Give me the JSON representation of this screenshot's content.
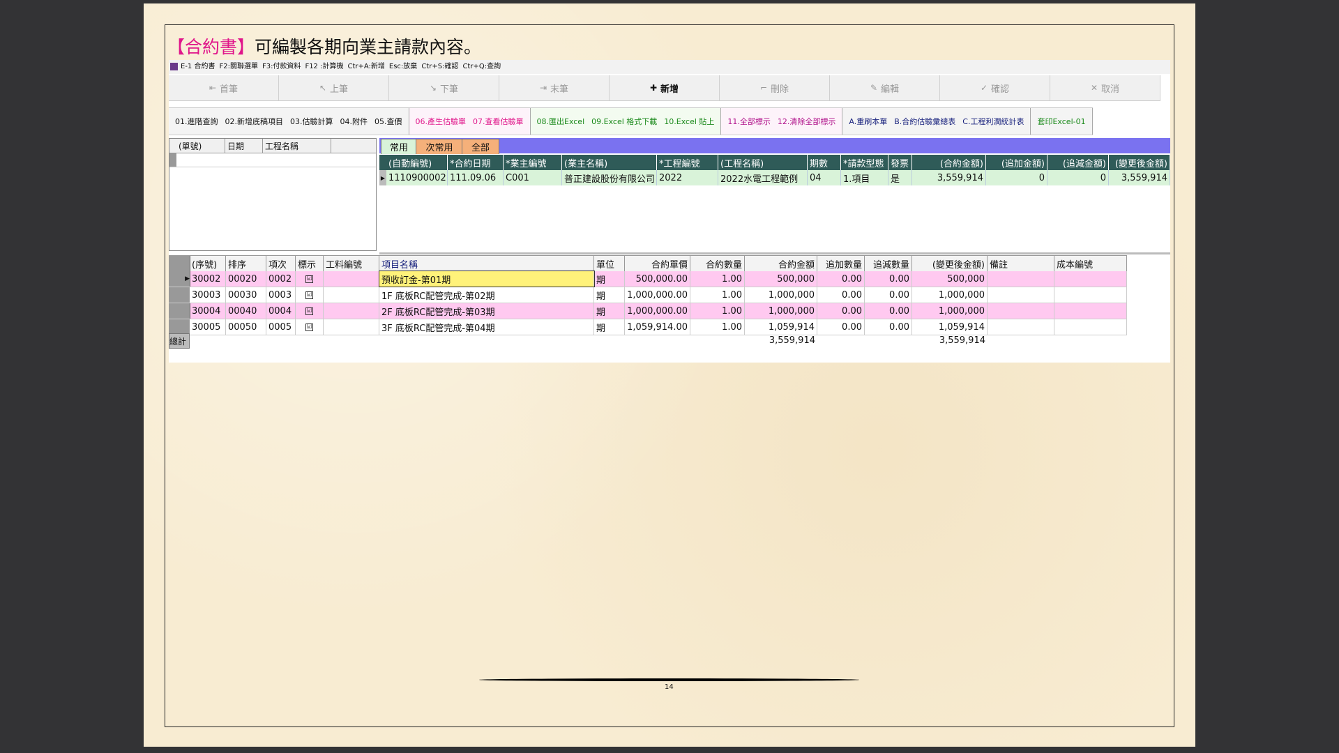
{
  "heading": {
    "bracket": "【合約書】",
    "text": "可編製各期向業主請款內容。"
  },
  "hotkeys": [
    "E-1 合約書",
    "F2:關聯選單",
    "F3:付款資料",
    "F12 :計算機",
    "Ctr+A:新增",
    "Esc:放棄",
    "Ctr+S:確認",
    "Ctr+Q:查詢"
  ],
  "nav": [
    {
      "label": "首筆",
      "glyph": "⇤",
      "active": false
    },
    {
      "label": "上筆",
      "glyph": "↖",
      "active": false
    },
    {
      "label": "下筆",
      "glyph": "↘",
      "active": false
    },
    {
      "label": "末筆",
      "glyph": "⇥",
      "active": false
    },
    {
      "label": "新增",
      "glyph": "✚",
      "active": true
    },
    {
      "label": "刪除",
      "glyph": "⌐",
      "active": false
    },
    {
      "label": "編輯",
      "glyph": "✎",
      "active": false
    },
    {
      "label": "確認",
      "glyph": "✓",
      "active": false
    },
    {
      "label": "取消",
      "glyph": "✕",
      "active": false
    }
  ],
  "func_groups": [
    {
      "cls": "g1",
      "items": [
        "01.進階查詢",
        "02.新增底稿項目",
        "03.估驗計算",
        "04.附件",
        "05.查價"
      ]
    },
    {
      "cls": "g2",
      "items": [
        "06.產生估驗單",
        "07.查看估驗單"
      ]
    },
    {
      "cls": "g3",
      "items": [
        "08.匯出Excel",
        "09.Excel 格式下載",
        "10.Excel 貼上"
      ]
    },
    {
      "cls": "g4",
      "items": [
        "11.全部標示",
        "12.清除全部標示"
      ]
    },
    {
      "cls": "g5",
      "items": [
        "A.重刷本單",
        "B.合約估驗彙總表",
        "C.工程利潤統計表"
      ]
    },
    {
      "cls": "g6",
      "items": [
        "套印Excel-01"
      ]
    }
  ],
  "left_headers": [
    "(單號)",
    "日期",
    "工程名稱"
  ],
  "tabs": [
    {
      "label": "常用",
      "bg": "#d9f3d9"
    },
    {
      "label": "次常用",
      "bg": "#f5b07a"
    },
    {
      "label": "全部",
      "bg": "#f5b07a"
    }
  ],
  "top_headers": [
    "(自動編號)",
    "*合約日期",
    "*業主編號",
    "(業主名稱)",
    "*工程編號",
    "(工程名稱)",
    "期數",
    "*請款型態",
    "發票",
    "(合約金額)",
    "(追加金額)",
    "(追減金額)",
    "(變更後金額)"
  ],
  "top_row": [
    "1110900002",
    "111.09.06",
    "C001",
    "普正建設股份有限公司",
    "2022",
    "2022水電工程範例",
    "04",
    "1.項目",
    "是",
    "3,559,914",
    "0",
    "0",
    "3,559,914"
  ],
  "bot_headers": [
    "(序號)",
    "排序",
    "項次",
    "標示",
    "工料編號",
    "項目名稱",
    "單位",
    "合約單價",
    "合約數量",
    "合約金額",
    "追加數量",
    "追減數量",
    "(變更後金額)",
    "備註",
    "成本編號"
  ],
  "bot_rows": [
    [
      "30002",
      "00020",
      "0002",
      "☑",
      "",
      "預收訂金-第01期",
      "期",
      "500,000.00",
      "1.00",
      "500,000",
      "0.00",
      "0.00",
      "500,000",
      "",
      ""
    ],
    [
      "30003",
      "00030",
      "0003",
      "☑",
      "",
      "1F 底板RC配管完成-第02期",
      "期",
      "1,000,000.00",
      "1.00",
      "1,000,000",
      "0.00",
      "0.00",
      "1,000,000",
      "",
      ""
    ],
    [
      "30004",
      "00040",
      "0004",
      "☑",
      "",
      "2F 底板RC配管完成-第03期",
      "期",
      "1,000,000.00",
      "1.00",
      "1,000,000",
      "0.00",
      "0.00",
      "1,000,000",
      "",
      ""
    ],
    [
      "30005",
      "00050",
      "0005",
      "☑",
      "",
      "3F 底板RC配管完成-第04期",
      "期",
      "1,059,914.00",
      "1.00",
      "1,059,914",
      "0.00",
      "0.00",
      "1,059,914",
      "",
      ""
    ]
  ],
  "summary": {
    "label": "總計",
    "contract_total": "3,559,914",
    "changed_total": "3,559,914"
  },
  "page_number": "14"
}
